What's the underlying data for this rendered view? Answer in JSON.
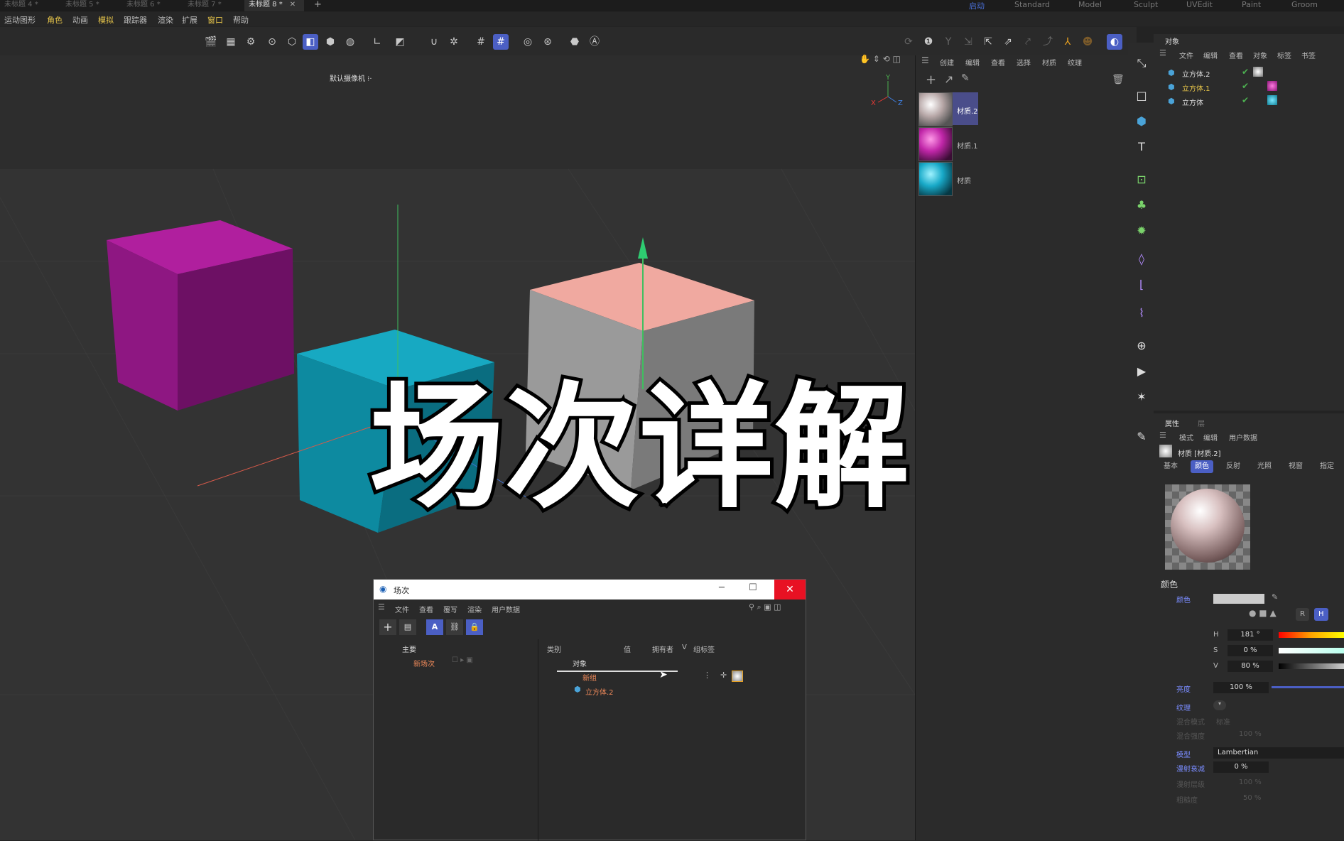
{
  "tabs": [
    "未标题 4 *",
    "未标题 5 *",
    "未标题 6 *",
    "未标题 7 *",
    "未标题 8 *"
  ],
  "active_tab": "未标题 8 *",
  "layouts": [
    "启动",
    "Standard",
    "Model",
    "Sculpt",
    "UVEdit",
    "Paint",
    "Groom"
  ],
  "menus": [
    "运动图形",
    "角色",
    "动画",
    "模拟",
    "跟踪器",
    "渲染",
    "扩展",
    "窗口",
    "帮助"
  ],
  "viewport": {
    "camera": "默认摄像机 ⁝·",
    "caption": "场次详解"
  },
  "material_menu": [
    "创建",
    "编辑",
    "查看",
    "选择",
    "材质",
    "纹理"
  ],
  "materials": [
    "材质.2",
    "材质.1",
    "材质"
  ],
  "object_panel": {
    "title": "对象",
    "menu": [
      "文件",
      "编辑",
      "查看",
      "对象",
      "标签",
      "书签"
    ],
    "objects": [
      "立方体.2",
      "立方体.1",
      "立方体"
    ]
  },
  "attributes": {
    "tab": "属性",
    "tab2": "层",
    "menu": [
      "模式",
      "编辑",
      "用户数据"
    ],
    "material_name": "材质 [材质.2]",
    "channel_tabs": [
      "基本",
      "颜色",
      "反射",
      "光照",
      "视窗",
      "指定"
    ],
    "section": "颜色",
    "color_label": "颜色",
    "h": "181 °",
    "s": "0 %",
    "v": "80 %",
    "brightness_label": "亮度",
    "brightness": "100 %",
    "texture_label": "纹理",
    "blend_mode_label": "混合模式",
    "blend_mode": "标准",
    "blend_strength_label": "混合强度",
    "blend_strength": "100 %",
    "model_label": "模型",
    "model": "Lambertian",
    "diffuse_label": "漫射衰减",
    "diffuse": "0 %",
    "diffuse_level_label": "漫射层级",
    "diffuse_level": "100 %",
    "roughness_label": "粗糙度",
    "roughness": "50 %"
  },
  "scene_window": {
    "title": "场次",
    "menu": [
      "文件",
      "查看",
      "覆写",
      "渲染",
      "用户数据"
    ],
    "tree": [
      "主要",
      "新场次"
    ],
    "columns": [
      "类别",
      "值",
      "拥有者",
      "V",
      "组标签"
    ],
    "rows": [
      "对象",
      "新组",
      "立方体.2"
    ]
  }
}
